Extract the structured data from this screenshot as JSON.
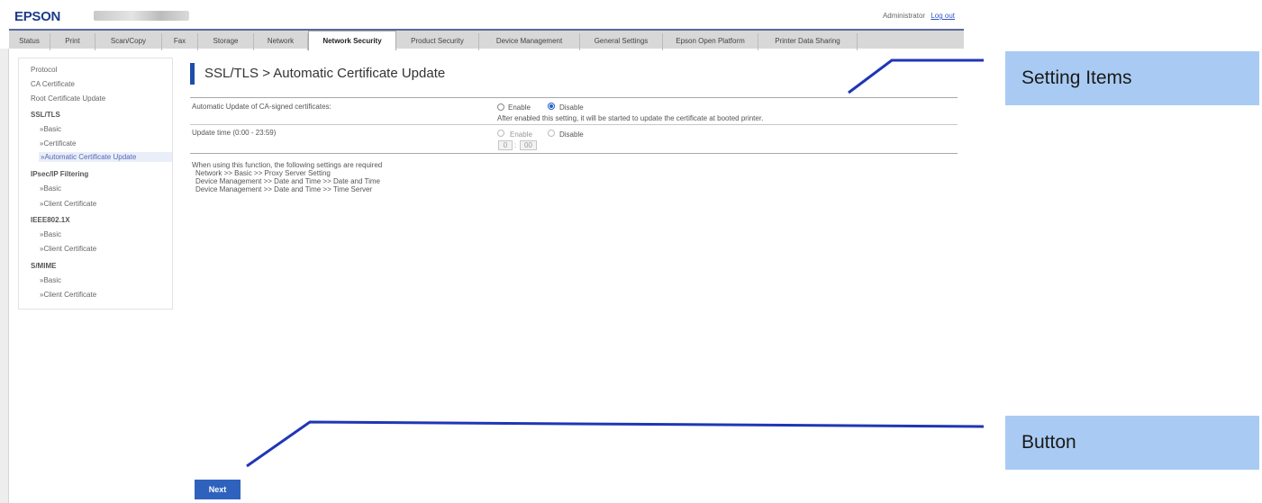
{
  "header": {
    "logo": "EPSON",
    "user": "Administrator",
    "logout": "Log out"
  },
  "tabs": [
    {
      "label": "Status"
    },
    {
      "label": "Print"
    },
    {
      "label": "Scan/Copy"
    },
    {
      "label": "Fax"
    },
    {
      "label": "Storage"
    },
    {
      "label": "Network"
    },
    {
      "label": "Network Security"
    },
    {
      "label": "Product Security"
    },
    {
      "label": "Device Management"
    },
    {
      "label": "General Settings"
    },
    {
      "label": "Epson Open Platform"
    },
    {
      "label": "Printer Data Sharing"
    }
  ],
  "active_tab": "Network Security",
  "sidebar": {
    "items": [
      {
        "label": "Protocol"
      },
      {
        "label": "CA Certificate"
      },
      {
        "label": "Root Certificate Update"
      },
      {
        "label": "SSL/TLS"
      },
      {
        "label": "»Basic"
      },
      {
        "label": "»Certificate"
      },
      {
        "label": "»Automatic Certificate Update"
      },
      {
        "label": "IPsec/IP Filtering"
      },
      {
        "label": "»Basic"
      },
      {
        "label": "»Client Certificate"
      },
      {
        "label": "IEEE802.1X"
      },
      {
        "label": "»Basic"
      },
      {
        "label": "»Client Certificate"
      },
      {
        "label": "S/MIME"
      },
      {
        "label": "»Basic"
      },
      {
        "label": "»Client Certificate"
      }
    ]
  },
  "main": {
    "title": "SSL/TLS > Automatic Certificate Update",
    "auto_update": {
      "label": "Automatic Update of CA-signed certificates:",
      "enable": "Enable",
      "disable": "Disable",
      "selected": "Disable",
      "note": "After enabled this setting, it will be started to update the certificate at booted printer."
    },
    "update_time": {
      "label": "Update time (0:00 - 23:59)",
      "enable": "Enable",
      "disable": "Disable",
      "hour": "0",
      "minute": "00",
      "sep": ":"
    },
    "info": {
      "intro": "When using this function, the following settings are required",
      "line1": "Network >> Basic >> Proxy Server Setting",
      "line2": "Device Management >> Date and Time >> Date and Time",
      "line3": "Device Management >> Date and Time >> Time Server"
    },
    "next_button": "Next"
  },
  "annotations": {
    "setting_items": "Setting Items",
    "button": "Button",
    "line_color": "#1f36b5"
  }
}
